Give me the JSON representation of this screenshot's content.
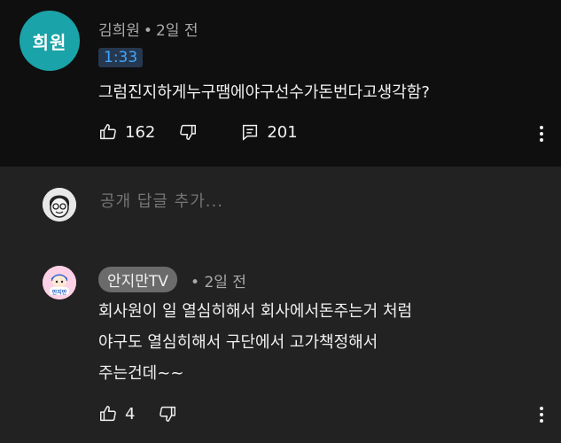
{
  "comment1": {
    "avatar_text": "희원",
    "author": "김희원",
    "separator": "•",
    "time_ago": "2일 전",
    "timestamp_link": "1:33",
    "text": "그럼진지하게누구땜에야구선수가돈번다고생각함?",
    "likes": "162",
    "replies": "201",
    "icons": [
      "thumb-up-icon",
      "thumb-down-icon",
      "comment-icon",
      "more-vert-icon"
    ]
  },
  "reply_box": {
    "placeholder": "공개 답글 추가...",
    "icons": [
      "user-avatar-icon"
    ]
  },
  "comment2": {
    "author_badge": "안지만TV",
    "separator": "•",
    "time_ago": "2일 전",
    "avatar_text": "안지만",
    "lines": [
      "회사원이 일 열심히해서 회사에서돈주는거 처럼",
      "야구도 열심히해서 구단에서 고가책정해서",
      "주는건데~~"
    ],
    "likes": "4",
    "icons": [
      "thumb-up-icon",
      "thumb-down-icon",
      "more-vert-icon"
    ]
  },
  "colors": {
    "background": "#0f0f0f",
    "reply_background": "#222222",
    "avatar_teal": "#1aa3a8",
    "timestamp_link": "#3ea6ff",
    "badge_gray": "#6b6b6b",
    "secondary_text": "#aaaaaa"
  }
}
